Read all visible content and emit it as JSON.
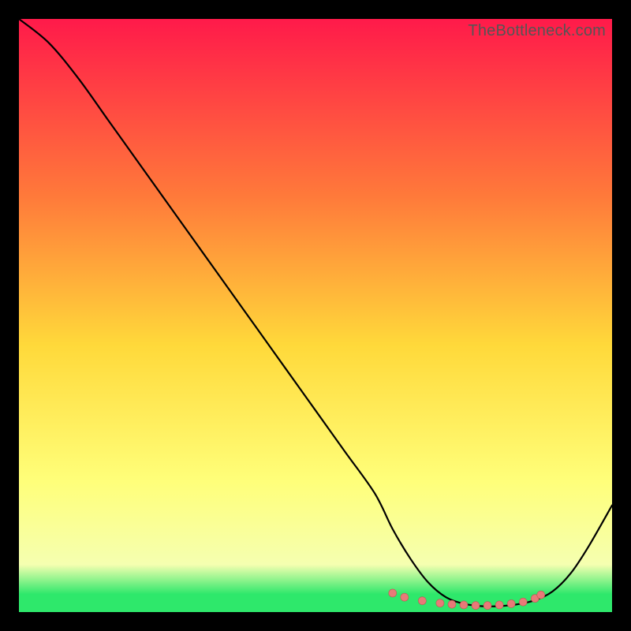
{
  "watermark": "TheBottleneck.com",
  "colors": {
    "gradient_top": "#ff1a4a",
    "gradient_mid1": "#ff7a3a",
    "gradient_mid2": "#ffd93a",
    "gradient_mid3": "#ffff7a",
    "gradient_bottom_band": "#f5ffb0",
    "gradient_green": "#2ee86b",
    "curve": "#000000",
    "marker_fill": "#e87a78",
    "marker_stroke": "#c05552",
    "frame_bg": "#000000"
  },
  "chart_data": {
    "type": "line",
    "title": "",
    "xlabel": "",
    "ylabel": "",
    "xlim": [
      0,
      100
    ],
    "ylim": [
      0,
      100
    ],
    "series": [
      {
        "name": "bottleneck-curve",
        "x": [
          0,
          5,
          10,
          15,
          20,
          25,
          30,
          35,
          40,
          45,
          50,
          55,
          60,
          63,
          66,
          69,
          72,
          75,
          78,
          81,
          84,
          87,
          90,
          93,
          96,
          100
        ],
        "y": [
          100,
          96,
          90,
          83,
          76,
          69,
          62,
          55,
          48,
          41,
          34,
          27,
          20,
          14,
          9,
          5,
          2.5,
          1.4,
          1.0,
          1.0,
          1.3,
          2.0,
          3.5,
          6.5,
          11,
          18
        ]
      }
    ],
    "markers": {
      "name": "highlighted-range",
      "x": [
        63,
        65,
        68,
        71,
        73,
        75,
        77,
        79,
        81,
        83,
        85,
        87,
        88
      ],
      "y": [
        3.2,
        2.5,
        1.9,
        1.5,
        1.3,
        1.2,
        1.1,
        1.1,
        1.2,
        1.4,
        1.7,
        2.3,
        2.9
      ]
    }
  }
}
